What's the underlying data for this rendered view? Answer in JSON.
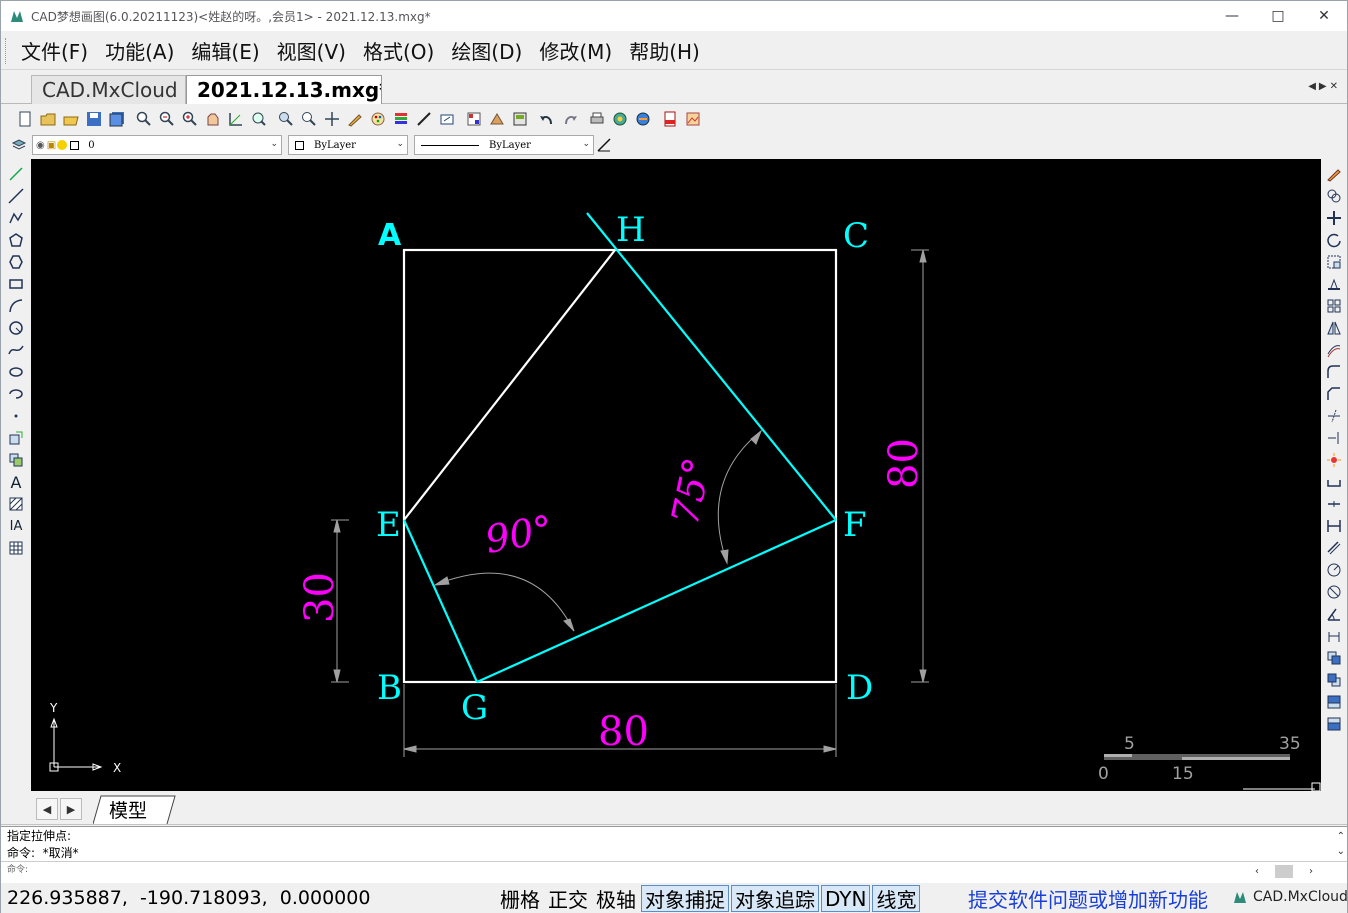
{
  "window": {
    "title": "CAD梦想画图(6.0.20211123)<姓赵的呀。,会员1> - 2021.12.13.mxg*",
    "minimize_icon": "minimize-icon",
    "maximize_icon": "maximize-icon",
    "close_icon": "close-icon"
  },
  "menu": [
    "文件(F)",
    "功能(A)",
    "编辑(E)",
    "视图(V)",
    "格式(O)",
    "绘图(D)",
    "修改(M)",
    "帮助(H)"
  ],
  "tabs": [
    {
      "label": "CAD.MxCloud",
      "active": false
    },
    {
      "label": "2021.12.13.mxg*",
      "active": true
    }
  ],
  "toolbar2": {
    "layer_value": "0",
    "color_value": "ByLayer",
    "linetype_value": "ByLayer"
  },
  "drawing": {
    "point_labels": [
      "A",
      "H",
      "C",
      "E",
      "F",
      "B",
      "G",
      "D"
    ],
    "dimensions": {
      "bottom": "80",
      "right": "80",
      "left": "30"
    },
    "angles": {
      "left": "90°",
      "right": "75°"
    },
    "scale_labels": [
      "5",
      "35",
      "0",
      "15"
    ],
    "ucs": {
      "x": "X",
      "y": "Y"
    }
  },
  "layout": {
    "tab_label": "模型"
  },
  "command": {
    "lines": [
      "指定拉伸点:",
      "命令:  *取消*"
    ],
    "input_label": "命令:"
  },
  "status": {
    "coords": "226.935887,  -190.718093,  0.000000",
    "buttons": [
      {
        "label": "栅格",
        "on": false
      },
      {
        "label": "正交",
        "on": false
      },
      {
        "label": "极轴",
        "on": false
      },
      {
        "label": "对象捕捉",
        "on": true
      },
      {
        "label": "对象追踪",
        "on": true
      },
      {
        "label": "DYN",
        "on": true
      },
      {
        "label": "线宽",
        "on": true
      }
    ],
    "submit_link": "提交软件问题或增加新功能",
    "brand": "CAD.MxCloud"
  },
  "colors": {
    "canvas_bg": "#000000",
    "square": "#ffffff",
    "cyan": "#00ffff",
    "magenta": "#ff00ff",
    "dim_gray": "#a0a0a0",
    "status_on": "#d9e8f7",
    "link": "#1a3fd6"
  }
}
